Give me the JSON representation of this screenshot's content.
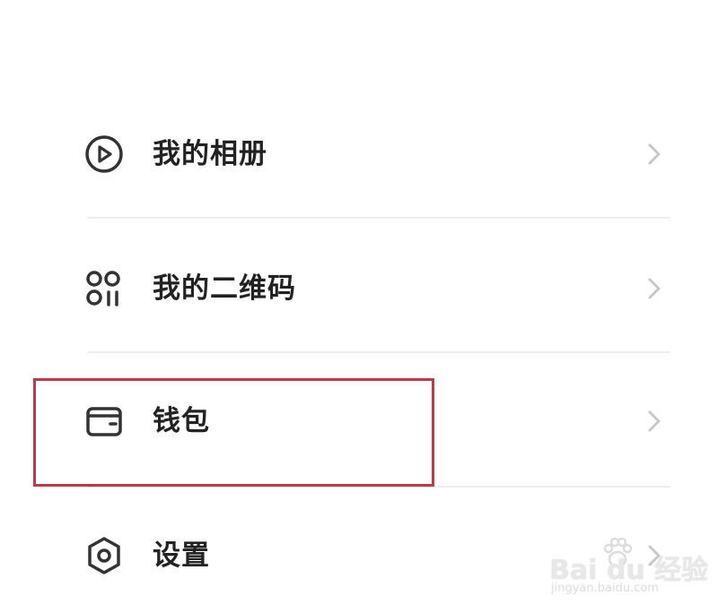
{
  "menu": {
    "items": [
      {
        "label": "我的相册",
        "icon": "play-circle-icon"
      },
      {
        "label": "我的二维码",
        "icon": "qr-dots-icon"
      },
      {
        "label": "钱包",
        "icon": "wallet-icon"
      },
      {
        "label": "设置",
        "icon": "hexagon-gear-icon"
      }
    ]
  },
  "highlight": {
    "target": "钱包",
    "color": "#c0394a"
  },
  "watermark": {
    "brand": "Bai du 经验",
    "url": "jingyan.baidu.com"
  },
  "colors": {
    "text": "#222222",
    "icon": "#333333",
    "chevron": "#c8c8c8",
    "divider": "#eeeeee"
  }
}
